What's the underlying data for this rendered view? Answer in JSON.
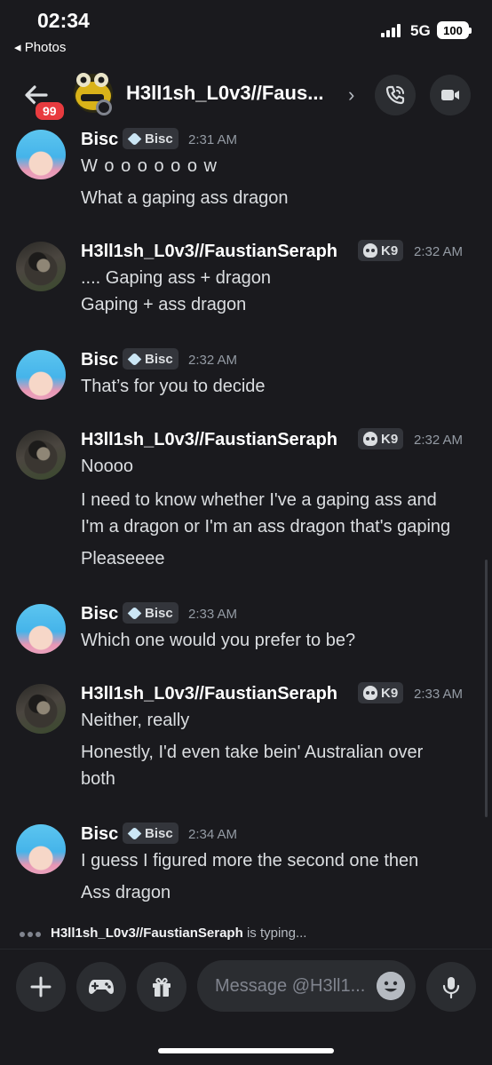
{
  "status_bar": {
    "time": "02:34",
    "back_label": "◂ Photos",
    "network": "5G",
    "battery": "100"
  },
  "header": {
    "channel_name": "H3ll1sh_L0v3//Faus...",
    "unread_count": "99"
  },
  "messages": [
    {
      "author": "Bisc",
      "tag": "Bisc",
      "tag_icon": "heart-icon",
      "time": "2:31 AM",
      "lines": [
        "W o o o o o o w",
        "What a gaping ass dragon"
      ]
    },
    {
      "author": "H3ll1sh_L0v3//FaustianSeraph",
      "tag": "K9",
      "tag_icon": "skull-icon",
      "time": "2:32 AM",
      "lines": [
        ".... Gaping ass + dragon",
        "Gaping + ass dragon"
      ]
    },
    {
      "author": "Bisc",
      "tag": "Bisc",
      "tag_icon": "heart-icon",
      "time": "2:32 AM",
      "lines": [
        "That’s for you to decide"
      ]
    },
    {
      "author": "H3ll1sh_L0v3//FaustianSeraph",
      "tag": "K9",
      "tag_icon": "skull-icon",
      "time": "2:32 AM",
      "lines": [
        "Noooo",
        "I need to know whether I've a gaping ass and",
        "I'm a dragon or I'm an ass dragon that's gaping",
        "Pleaseeee"
      ]
    },
    {
      "author": "Bisc",
      "tag": "Bisc",
      "tag_icon": "heart-icon",
      "time": "2:33 AM",
      "lines": [
        "Which one would you prefer to be?"
      ]
    },
    {
      "author": "H3ll1sh_L0v3//FaustianSeraph",
      "tag": "K9",
      "tag_icon": "skull-icon",
      "time": "2:33 AM",
      "lines": [
        "Neither, really",
        "Honestly, I'd even take bein' Australian over",
        "both"
      ]
    },
    {
      "author": "Bisc",
      "tag": "Bisc",
      "tag_icon": "heart-icon",
      "time": "2:34 AM",
      "lines": [
        "I guess I figured more the second one then",
        "Ass dragon"
      ]
    }
  ],
  "typing": {
    "user": "H3ll1sh_L0v3//FaustianSeraph",
    "suffix": "is typing..."
  },
  "composer": {
    "placeholder": "Message @H3ll1..."
  },
  "colors": {
    "background": "#1a1a1e",
    "badge_red": "#e83b3f",
    "muted": "#949ba4"
  }
}
